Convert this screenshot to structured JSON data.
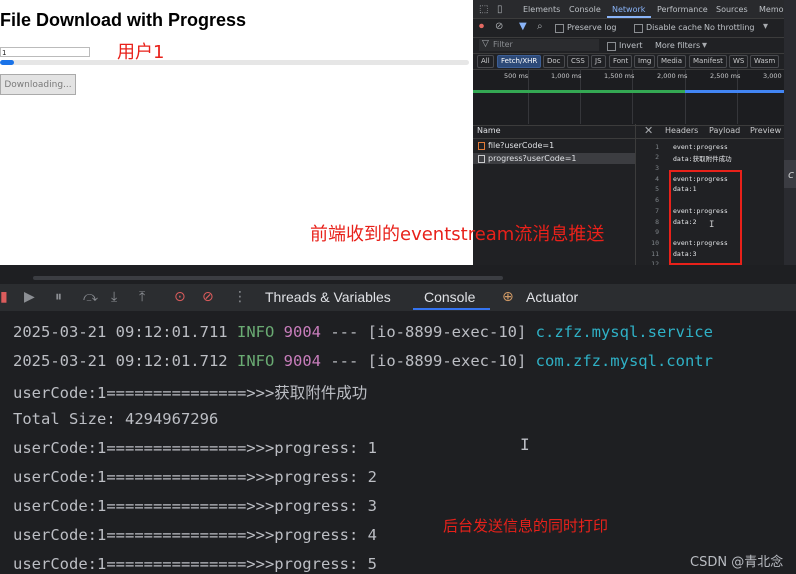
{
  "page": {
    "title": "File Download with Progress",
    "input_value": "1",
    "progress_percent": 3,
    "download_button": "Downloading...",
    "annotation_user": "用户1",
    "annotation_frontend": "前端收到的eventstream流消息推送"
  },
  "devtools": {
    "tabs": [
      "Elements",
      "Console",
      "Network",
      "Performance",
      "Sources",
      "Memo"
    ],
    "active_tab": "Network",
    "toolbar": {
      "preserve_log": "Preserve log",
      "disable_cache": "Disable cache",
      "throttling": "No throttling"
    },
    "filter": {
      "placeholder": "Filter",
      "invert": "Invert",
      "more_filters": "More filters"
    },
    "type_filters": [
      "All",
      "Fetch/XHR",
      "Doc",
      "CSS",
      "JS",
      "Font",
      "Img",
      "Media",
      "Manifest",
      "WS",
      "Wasm"
    ],
    "active_type": "Fetch/XHR",
    "ticks": [
      "500 ms",
      "1,000 ms",
      "1,500 ms",
      "2,000 ms",
      "2,500 ms",
      "3,000 r"
    ],
    "requests_header": "Name",
    "requests": [
      "file?userCode=1",
      "progress?userCode=1"
    ],
    "selected_request": "progress?userCode=1",
    "detail_tabs": [
      "Headers",
      "Payload",
      "Preview"
    ],
    "response_lines": [
      {
        "n": "1",
        "text": "event:progress"
      },
      {
        "n": "2",
        "text": "data:获取附件成功"
      },
      {
        "n": "3",
        "text": ""
      },
      {
        "n": "4",
        "text": "event:progress"
      },
      {
        "n": "5",
        "text": "data:1"
      },
      {
        "n": "6",
        "text": ""
      },
      {
        "n": "7",
        "text": "event:progress"
      },
      {
        "n": "8",
        "text": "data:2"
      },
      {
        "n": "9",
        "text": ""
      },
      {
        "n": "10",
        "text": "event:progress"
      },
      {
        "n": "11",
        "text": "data:3"
      },
      {
        "n": "12",
        "text": ""
      }
    ],
    "edge_letter": "c"
  },
  "ide": {
    "tabs": [
      "Threads & Variables",
      "Console",
      "Actuator"
    ],
    "active_tab": "Console",
    "logs": {
      "l1": {
        "ts": "2025-03-21 09:12:01.711",
        "level": "INFO",
        "pid": "9004",
        "sep": "---",
        "thread": "[io-8899-exec-10]",
        "cls": "c.zfz.mysql.service"
      },
      "l2": {
        "ts": "2025-03-21 09:12:01.712",
        "level": "INFO",
        "pid": "9004",
        "sep": "---",
        "thread": "[io-8899-exec-10]",
        "cls": "com.zfz.mysql.contr"
      },
      "l3": "userCode:1===============>>>获取附件成功",
      "l4": "Total Size: 4294967296",
      "l5": "userCode:1===============>>>progress: 1",
      "l6": "userCode:1===============>>>progress: 2",
      "l7": "userCode:1===============>>>progress: 3",
      "l8": "userCode:1===============>>>progress: 4",
      "l9": "userCode:1===============>>>progress: 5"
    },
    "annotation_backend": "后台发送信息的同时打印",
    "watermark": "CSDN @青北念"
  },
  "colors": {
    "annotation": "#e8211a",
    "accent_blue": "#3574f0",
    "info_green": "#6aab73",
    "pid_purple": "#c77dbb",
    "class_cyan": "#2fb1c6"
  }
}
